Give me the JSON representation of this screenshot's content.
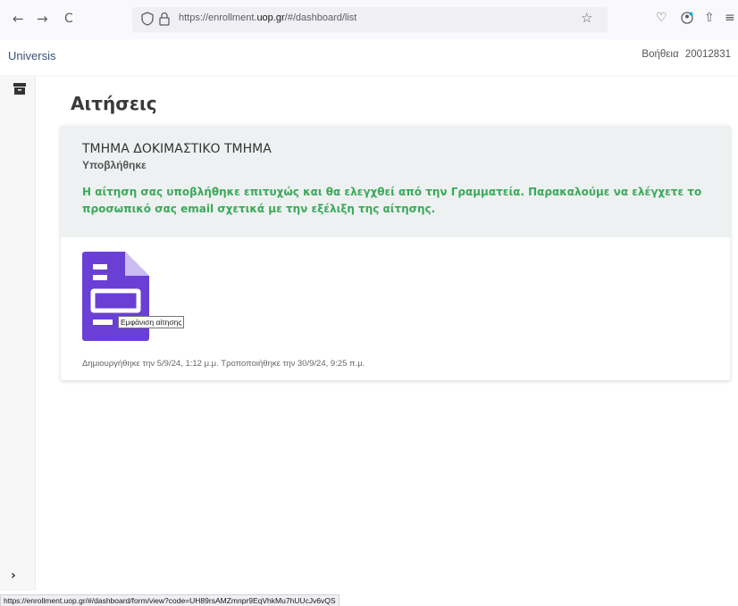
{
  "browser": {
    "url_prefix": "https://enrollment.",
    "url_domain": "uop.gr",
    "url_suffix": "/#/dashboard/list",
    "back_glyph": "←",
    "forward_glyph": "→",
    "reload_glyph": "C",
    "star_glyph": "☆",
    "pocket_glyph": "♡",
    "extensions_glyph": "⇧",
    "menu_glyph": "≡",
    "status_url": "https://enrollment.uop.gr/#/dashboard/form/view?code=UH89rsAMZmnpr9EqVhkMu7hUUcJv6vQS"
  },
  "header": {
    "brand": "Universis",
    "help_label": "Βοήθεια",
    "user_id": "20012831"
  },
  "sidebar": {
    "expand_glyph": "›"
  },
  "main": {
    "title": "Αιτήσεις",
    "application": {
      "department": "ΤΜΗΜΑ ΔΟΚΙΜΑΣΤΙΚΟ ΤΜΗΜΑ",
      "status": "Υποβλήθηκε",
      "message": "Η αίτηση σας υποβλήθηκε επιτυχώς και θα ελεγχθεί από την Γραμματεία.  Παρακαλούμε να ελέγχετε το προσωπικό σας email σχετικά με την εξέλιξη της αίτησης.",
      "view_tooltip": "Εμφάνιση αίτησης",
      "dates": "Δημιουργήθηκε την 5/9/24, 1:12 μ.μ.  Τροποποιήθηκε την 30/9/24, 9:25 π.μ."
    }
  },
  "colors": {
    "doc_icon": "#6a3fd6",
    "success_text": "#3aaa5a",
    "brand_text": "#3a4f7a"
  }
}
